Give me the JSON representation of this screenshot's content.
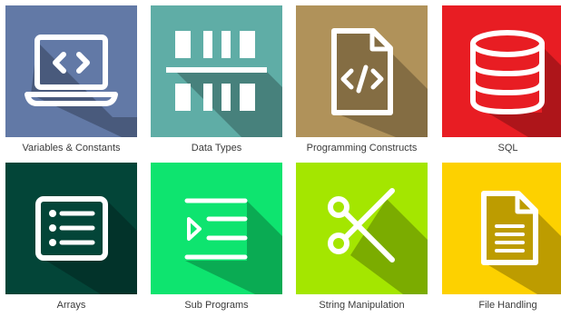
{
  "tiles": [
    {
      "label": "Variables & Constants",
      "color": "#6279a6",
      "icon": "laptop-code-icon"
    },
    {
      "label": "Data Types",
      "color": "#5fada6",
      "icon": "data-blocks-icon"
    },
    {
      "label": "Programming Constructs",
      "color": "#b0925a",
      "icon": "code-file-icon"
    },
    {
      "label": "SQL",
      "color": "#e81d23",
      "icon": "database-icon"
    },
    {
      "label": "Arrays",
      "color": "#034538",
      "icon": "list-icon"
    },
    {
      "label": "Sub Programs",
      "color": "#0ee46f",
      "icon": "indent-list-icon"
    },
    {
      "label": "String Manipulation",
      "color": "#a4e600",
      "icon": "scissors-icon"
    },
    {
      "label": "File Handling",
      "color": "#fdd100",
      "icon": "document-icon"
    }
  ]
}
